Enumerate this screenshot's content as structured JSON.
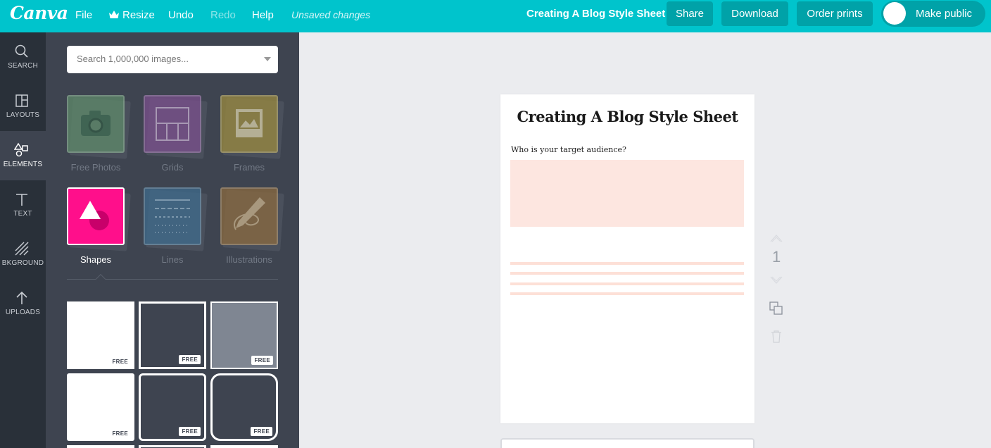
{
  "topbar": {
    "logo": "Canva",
    "menu": {
      "file": "File",
      "resize": "Resize",
      "undo": "Undo",
      "redo": "Redo",
      "help": "Help"
    },
    "status": "Unsaved changes",
    "document_title": "Creating A Blog Style Sheet",
    "share_label": "Share",
    "download_label": "Download",
    "order_prints_label": "Order prints",
    "make_public_label": "Make public",
    "make_public_on": false,
    "accent_color": "#00c4cc"
  },
  "rail": {
    "items": [
      {
        "label": "SEARCH",
        "icon": "search-icon"
      },
      {
        "label": "LAYOUTS",
        "icon": "layout-icon"
      },
      {
        "label": "ELEMENTS",
        "icon": "elements-icon",
        "active": true
      },
      {
        "label": "TEXT",
        "icon": "text-icon"
      },
      {
        "label": "BKGROUND",
        "icon": "background-icon"
      },
      {
        "label": "UPLOADS",
        "icon": "upload-icon"
      }
    ]
  },
  "panel": {
    "search_placeholder": "Search 1,000,000 images...",
    "categories": [
      {
        "label": "Free Photos",
        "icon": "camera-icon",
        "color": "#5e8a6a"
      },
      {
        "label": "Grids",
        "icon": "grid-icon",
        "color": "#7a4f8c"
      },
      {
        "label": "Frames",
        "icon": "frame-icon",
        "color": "#9a8a3f"
      },
      {
        "label": "Shapes",
        "icon": "shapes-icon",
        "color": "#ff0f8b",
        "active": true
      },
      {
        "label": "Lines",
        "icon": "lines-icon",
        "color": "#3f6b8c"
      },
      {
        "label": "Illustrations",
        "icon": "pencil-icon",
        "color": "#8a6a3f"
      }
    ],
    "shapes": [
      {
        "badge": "FREE",
        "fill": "#ffffff"
      },
      {
        "badge": "FREE",
        "fill": "#3e4450"
      },
      {
        "badge": "FREE",
        "fill": "#7f8692"
      },
      {
        "badge": "FREE",
        "fill": "#ffffff"
      },
      {
        "badge": "FREE",
        "fill": "#3e4450"
      },
      {
        "badge": "FREE",
        "fill": "#3e4450"
      }
    ]
  },
  "canvas": {
    "title": "Creating A Blog Style Sheet",
    "question": "Who is your target audience?",
    "page_number": "1",
    "box_color": "#fde6e0"
  }
}
